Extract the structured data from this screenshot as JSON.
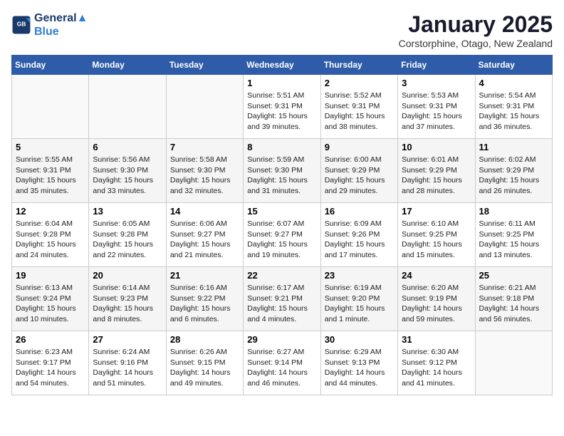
{
  "header": {
    "logo_line1": "General",
    "logo_line2": "Blue",
    "title": "January 2025",
    "subtitle": "Corstorphine, Otago, New Zealand"
  },
  "weekdays": [
    "Sunday",
    "Monday",
    "Tuesday",
    "Wednesday",
    "Thursday",
    "Friday",
    "Saturday"
  ],
  "weeks": [
    [
      {
        "day": "",
        "info": ""
      },
      {
        "day": "",
        "info": ""
      },
      {
        "day": "",
        "info": ""
      },
      {
        "day": "1",
        "info": "Sunrise: 5:51 AM\nSunset: 9:31 PM\nDaylight: 15 hours\nand 39 minutes."
      },
      {
        "day": "2",
        "info": "Sunrise: 5:52 AM\nSunset: 9:31 PM\nDaylight: 15 hours\nand 38 minutes."
      },
      {
        "day": "3",
        "info": "Sunrise: 5:53 AM\nSunset: 9:31 PM\nDaylight: 15 hours\nand 37 minutes."
      },
      {
        "day": "4",
        "info": "Sunrise: 5:54 AM\nSunset: 9:31 PM\nDaylight: 15 hours\nand 36 minutes."
      }
    ],
    [
      {
        "day": "5",
        "info": "Sunrise: 5:55 AM\nSunset: 9:31 PM\nDaylight: 15 hours\nand 35 minutes."
      },
      {
        "day": "6",
        "info": "Sunrise: 5:56 AM\nSunset: 9:30 PM\nDaylight: 15 hours\nand 33 minutes."
      },
      {
        "day": "7",
        "info": "Sunrise: 5:58 AM\nSunset: 9:30 PM\nDaylight: 15 hours\nand 32 minutes."
      },
      {
        "day": "8",
        "info": "Sunrise: 5:59 AM\nSunset: 9:30 PM\nDaylight: 15 hours\nand 31 minutes."
      },
      {
        "day": "9",
        "info": "Sunrise: 6:00 AM\nSunset: 9:29 PM\nDaylight: 15 hours\nand 29 minutes."
      },
      {
        "day": "10",
        "info": "Sunrise: 6:01 AM\nSunset: 9:29 PM\nDaylight: 15 hours\nand 28 minutes."
      },
      {
        "day": "11",
        "info": "Sunrise: 6:02 AM\nSunset: 9:29 PM\nDaylight: 15 hours\nand 26 minutes."
      }
    ],
    [
      {
        "day": "12",
        "info": "Sunrise: 6:04 AM\nSunset: 9:28 PM\nDaylight: 15 hours\nand 24 minutes."
      },
      {
        "day": "13",
        "info": "Sunrise: 6:05 AM\nSunset: 9:28 PM\nDaylight: 15 hours\nand 22 minutes."
      },
      {
        "day": "14",
        "info": "Sunrise: 6:06 AM\nSunset: 9:27 PM\nDaylight: 15 hours\nand 21 minutes."
      },
      {
        "day": "15",
        "info": "Sunrise: 6:07 AM\nSunset: 9:27 PM\nDaylight: 15 hours\nand 19 minutes."
      },
      {
        "day": "16",
        "info": "Sunrise: 6:09 AM\nSunset: 9:26 PM\nDaylight: 15 hours\nand 17 minutes."
      },
      {
        "day": "17",
        "info": "Sunrise: 6:10 AM\nSunset: 9:25 PM\nDaylight: 15 hours\nand 15 minutes."
      },
      {
        "day": "18",
        "info": "Sunrise: 6:11 AM\nSunset: 9:25 PM\nDaylight: 15 hours\nand 13 minutes."
      }
    ],
    [
      {
        "day": "19",
        "info": "Sunrise: 6:13 AM\nSunset: 9:24 PM\nDaylight: 15 hours\nand 10 minutes."
      },
      {
        "day": "20",
        "info": "Sunrise: 6:14 AM\nSunset: 9:23 PM\nDaylight: 15 hours\nand 8 minutes."
      },
      {
        "day": "21",
        "info": "Sunrise: 6:16 AM\nSunset: 9:22 PM\nDaylight: 15 hours\nand 6 minutes."
      },
      {
        "day": "22",
        "info": "Sunrise: 6:17 AM\nSunset: 9:21 PM\nDaylight: 15 hours\nand 4 minutes."
      },
      {
        "day": "23",
        "info": "Sunrise: 6:19 AM\nSunset: 9:20 PM\nDaylight: 15 hours\nand 1 minute."
      },
      {
        "day": "24",
        "info": "Sunrise: 6:20 AM\nSunset: 9:19 PM\nDaylight: 14 hours\nand 59 minutes."
      },
      {
        "day": "25",
        "info": "Sunrise: 6:21 AM\nSunset: 9:18 PM\nDaylight: 14 hours\nand 56 minutes."
      }
    ],
    [
      {
        "day": "26",
        "info": "Sunrise: 6:23 AM\nSunset: 9:17 PM\nDaylight: 14 hours\nand 54 minutes."
      },
      {
        "day": "27",
        "info": "Sunrise: 6:24 AM\nSunset: 9:16 PM\nDaylight: 14 hours\nand 51 minutes."
      },
      {
        "day": "28",
        "info": "Sunrise: 6:26 AM\nSunset: 9:15 PM\nDaylight: 14 hours\nand 49 minutes."
      },
      {
        "day": "29",
        "info": "Sunrise: 6:27 AM\nSunset: 9:14 PM\nDaylight: 14 hours\nand 46 minutes."
      },
      {
        "day": "30",
        "info": "Sunrise: 6:29 AM\nSunset: 9:13 PM\nDaylight: 14 hours\nand 44 minutes."
      },
      {
        "day": "31",
        "info": "Sunrise: 6:30 AM\nSunset: 9:12 PM\nDaylight: 14 hours\nand 41 minutes."
      },
      {
        "day": "",
        "info": ""
      }
    ]
  ]
}
